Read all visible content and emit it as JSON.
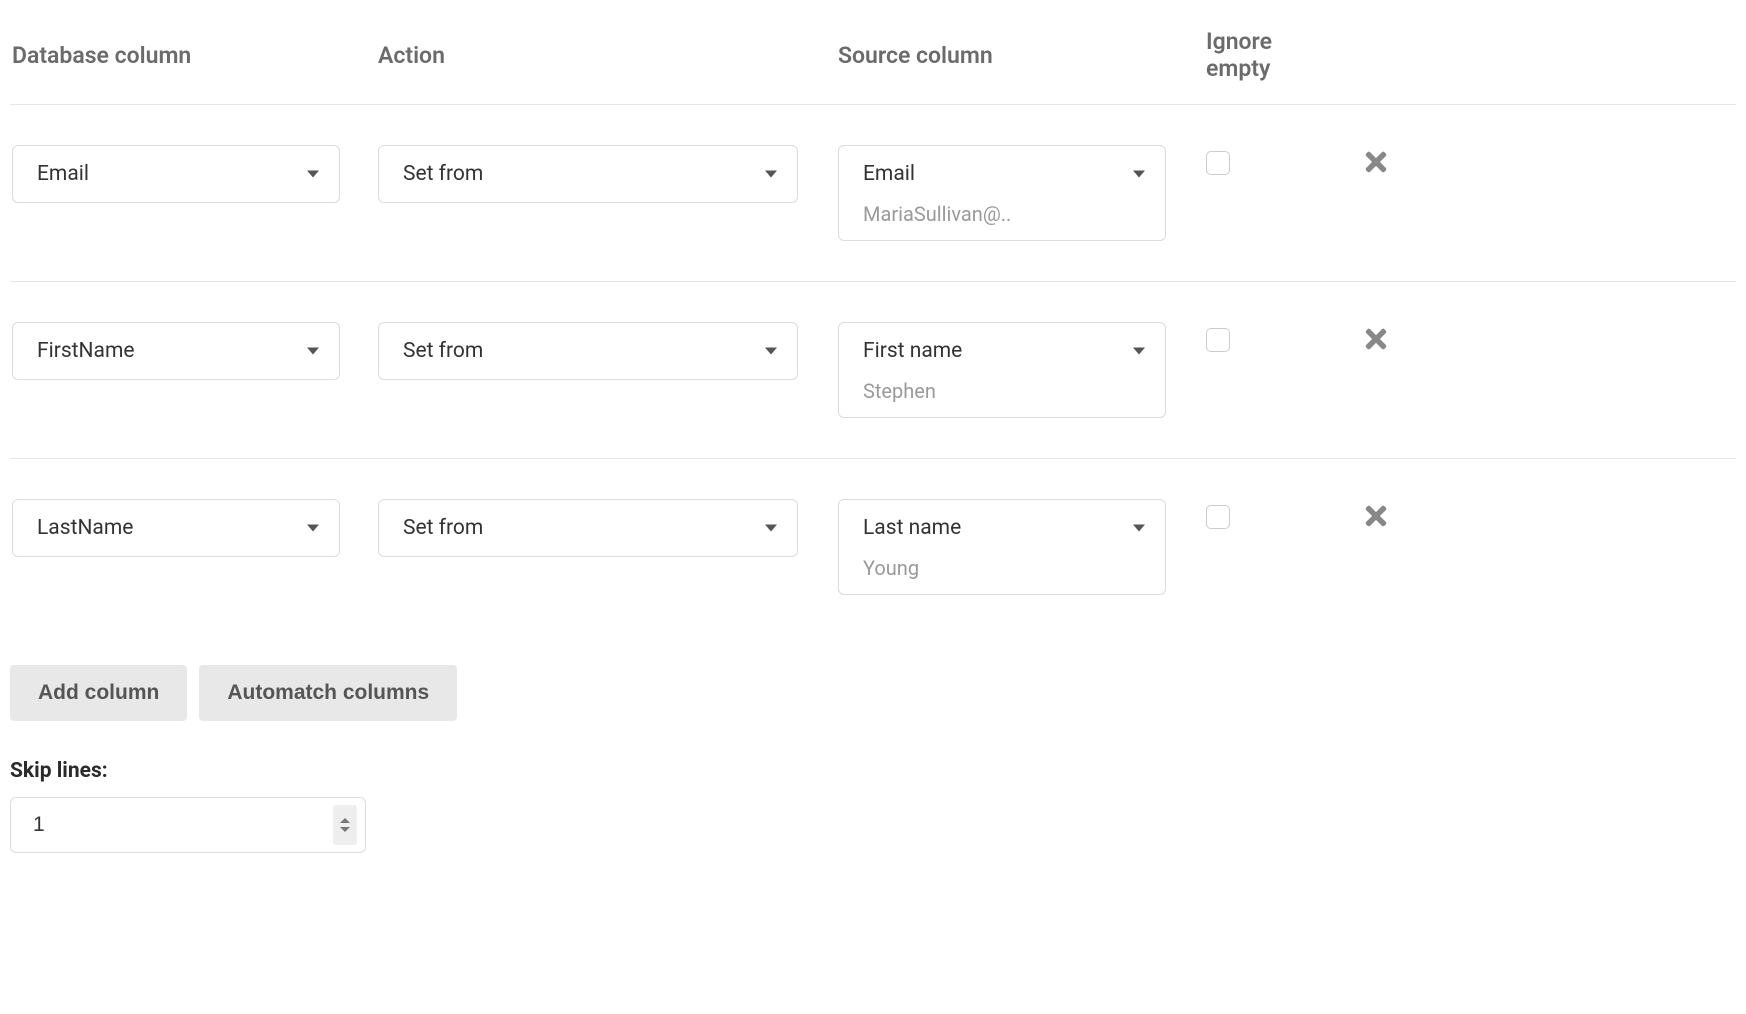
{
  "headers": {
    "database_column": "Database column",
    "action": "Action",
    "source_column": "Source column",
    "ignore_empty": "Ignore empty"
  },
  "rows": [
    {
      "db_column": "Email",
      "action": "Set from",
      "source_column": "Email",
      "source_preview": "MariaSullivan@..",
      "ignore_empty": false
    },
    {
      "db_column": "FirstName",
      "action": "Set from",
      "source_column": "First name",
      "source_preview": "Stephen",
      "ignore_empty": false
    },
    {
      "db_column": "LastName",
      "action": "Set from",
      "source_column": "Last name",
      "source_preview": "Young",
      "ignore_empty": false
    }
  ],
  "buttons": {
    "add_column": "Add column",
    "automatch": "Automatch columns"
  },
  "skip_lines": {
    "label": "Skip lines:",
    "value": "1"
  }
}
